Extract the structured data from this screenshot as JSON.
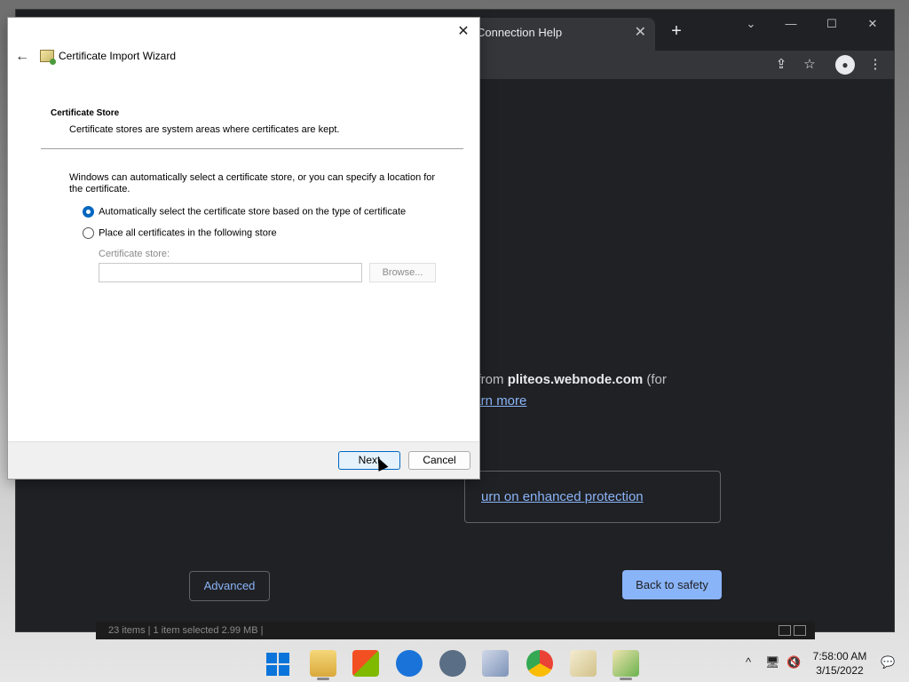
{
  "browser": {
    "tab_title": "Connection Help",
    "tab_close": "✕",
    "new_tab": "+",
    "window_controls": {
      "tab_search": "⌄",
      "minimize": "—",
      "maximize": "☐",
      "close": "✕"
    },
    "toolbar_icons": {
      "share": "⇪",
      "bookmark": "☆",
      "profile": "●",
      "menu": "⋮"
    },
    "content": {
      "line1_prefix": "n from ",
      "line1_domain": "pliteos.webnode.com",
      "line1_suffix": " (for",
      "learn_more": "earn more",
      "enhanced_protection": "urn on enhanced protection",
      "advanced_button": "Advanced",
      "back_to_safety": "Back to safety"
    },
    "colors": {
      "background": "#202124",
      "link": "#8ab4f8",
      "primary_button": "#8ab4f8"
    }
  },
  "explorer_status": {
    "text": "23 items  |  1 item selected  2.99 MB  |"
  },
  "wizard": {
    "title": "Certificate Import Wizard",
    "close": "✕",
    "back": "←",
    "section_title": "Certificate Store",
    "section_desc": "Certificate stores are system areas where certificates are kept.",
    "intro": "Windows can automatically select a certificate store, or you can specify a location for the certificate.",
    "options": [
      {
        "label": "Automatically select the certificate store based on the type of certificate",
        "checked": true
      },
      {
        "label": "Place all certificates in the following store",
        "checked": false
      }
    ],
    "store_label": "Certificate store:",
    "store_value": "",
    "browse_button": "Browse...",
    "next_button": "Next",
    "cancel_button": "Cancel"
  },
  "taskbar": {
    "apps": [
      "start-icon",
      "file-explorer-icon",
      "microsoft-store-icon",
      "snipping-tool-icon",
      "settings-icon",
      "media-player-icon",
      "chrome-icon",
      "certificate-icon",
      "certificate-import-icon"
    ],
    "tray": {
      "chevron": "^",
      "network": "🖥",
      "volume": "🔇",
      "notification": "💬"
    },
    "time": "7:58:00 AM",
    "date": "3/15/2022"
  }
}
